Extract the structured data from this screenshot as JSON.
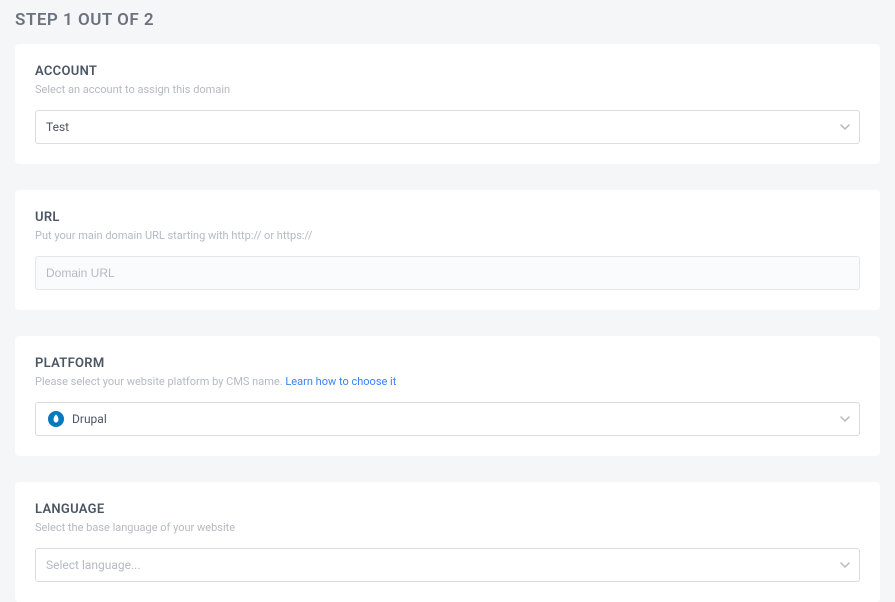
{
  "step_title": "STEP 1 OUT OF 2",
  "account": {
    "label": "ACCOUNT",
    "description": "Select an account to assign this domain",
    "value": "Test"
  },
  "url": {
    "label": "URL",
    "description": "Put your main domain URL starting with http:// or https://",
    "placeholder": "Domain URL"
  },
  "platform": {
    "label": "PLATFORM",
    "description_prefix": "Please select your website platform by CMS name. ",
    "link_text": "Learn how to choose it",
    "value": "Drupal"
  },
  "language": {
    "label": "LANGUAGE",
    "description": "Select the base language of your website",
    "placeholder": "Select language..."
  }
}
